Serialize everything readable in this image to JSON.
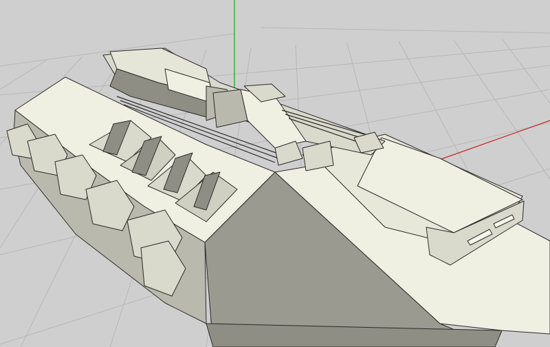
{
  "viewport": {
    "background_color": "#cfcfcf",
    "grid_color": "#b7b7b7",
    "axis_y_color": "#11aa22",
    "axis_x_color": "#cc2222",
    "model_light_color": "#efefe2",
    "model_mid_color": "#d9d9cc",
    "model_shadow_color": "#8e8e84",
    "model_dark_color": "#2a2a2a"
  },
  "scene": {
    "object": "3d-model-hover-tank"
  }
}
